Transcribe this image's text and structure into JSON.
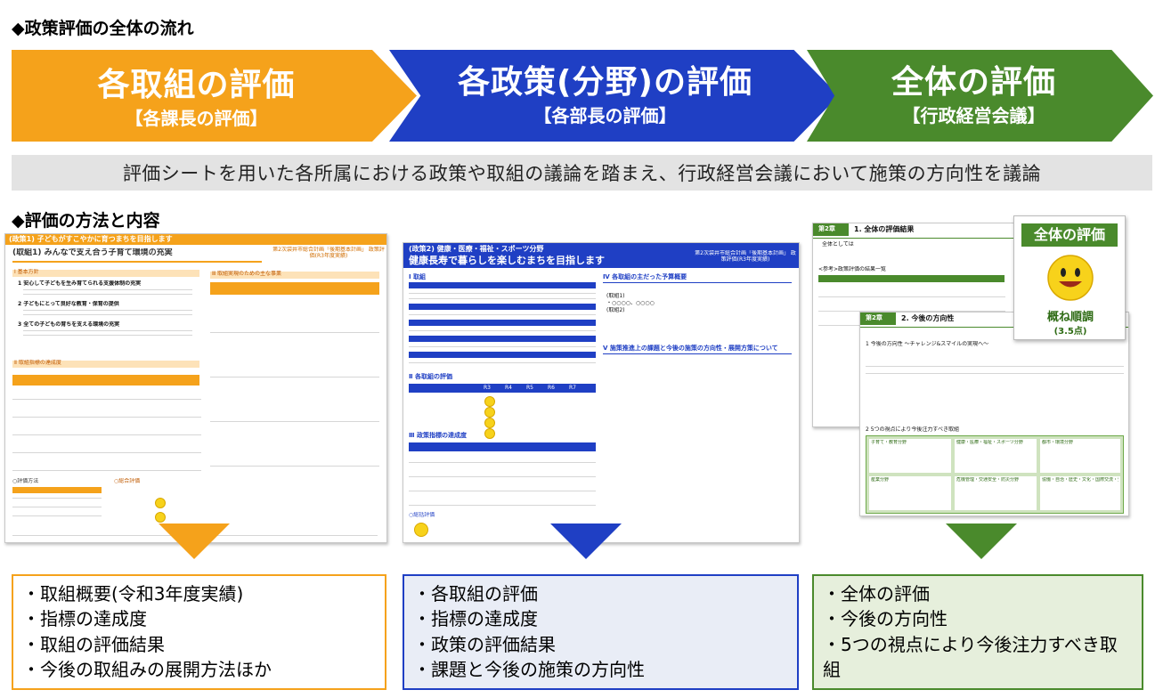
{
  "headings": {
    "flow": "◆政策評価の全体の流れ",
    "method": "◆評価の方法と内容"
  },
  "stages": [
    {
      "main": "各取組の評価",
      "sub": "【各課長の評価】",
      "color": "#f5a21b"
    },
    {
      "main": "各政策(分野)の評価",
      "sub": "【各部長の評価】",
      "color": "#1f3fc4"
    },
    {
      "main": "全体の評価",
      "sub": "【行政経営会議】",
      "color": "#4a8a2c"
    }
  ],
  "banner": "評価シートを用いた各所属における政策や取組の議論を踏まえ、行政経営会議において施策の方向性を議論",
  "sheet1": {
    "policy": "(政策1) 子どもがすこやかに育つまちを目指します",
    "plan": "第2次袋井市総合計画「後期基本計画」 政策評価(R3年度実績)",
    "title": "(取組1) みんなで支え合う子育て環境の充実",
    "sec1": "Ⅰ 基本方針",
    "sec2": "Ⅱ 取組指標の達成度",
    "sec3": "Ⅲ 取組実現のための主な事業",
    "items": [
      "1 安心して子どもを生み育てられる支援体制の充実",
      "2 子どもにとって良好な教育・保育の提供",
      "3 全ての子どもの育ちを支える環境の充実"
    ],
    "eval_label": "○評価方法",
    "overall_label": "○総合評価"
  },
  "sheet2": {
    "policy": "(政策2) 健康・医療・福祉・スポーツ分野",
    "title": "健康長寿で暮らしを楽しむまちを目指します",
    "plan": "第2次袋井市総合計画「後期基本計画」 政策評価(R3年度実績)",
    "sec1": "Ⅰ 取組",
    "sec2": "Ⅱ 各取組の評価",
    "sec3": "Ⅲ 政策指標の達成度",
    "sec4": "Ⅳ 各取組の主だった予算概要",
    "sec5": "Ⅴ 施策推進上の課題と今後の施策の方向性・展開方策について",
    "overall_label": "○総括評価",
    "years": [
      "R3",
      "R4",
      "R5",
      "R6",
      "R7"
    ],
    "sample_lines": [
      "(取組1)",
      "・○○○○、○○○○",
      "(取組2)"
    ]
  },
  "sheet3": {
    "sec1_tag": "第2章",
    "sec1": "1. 全体の評価結果",
    "sec1_text": "全体としては",
    "ref": "<参考>政策評価の結果一覧",
    "sec2_tag": "第2章",
    "sec2": "2. 今後の方向性",
    "sub1": "1 今後の方向性 〜チャレンジ&スマイルの実現へ〜",
    "sub2": "2 5つの視点により今後注力すべき取組",
    "viewpoints": [
      "子育て・教育分野",
      "健康・医療・福祉・スポーツ分野",
      "都市・環境分野",
      "産業分野",
      "危機管理・交通安全・防災分野",
      "協働・自治・歴史・文化・国際交流・生涯学習"
    ],
    "card_title": "全体の評価",
    "card_label": "概ね順調",
    "card_score": "(3.5点)"
  },
  "boxes": [
    [
      "・取組概要(令和3年度実績)",
      "・指標の達成度",
      "・取組の評価結果",
      "・今後の取組みの展開方法ほか"
    ],
    [
      "・各取組の評価",
      "・指標の達成度",
      "・政策の評価結果",
      "・課題と今後の施策の方向性"
    ],
    [
      "・全体の評価",
      "・今後の方向性",
      "・5つの視点により今後注力すべき取組"
    ]
  ]
}
